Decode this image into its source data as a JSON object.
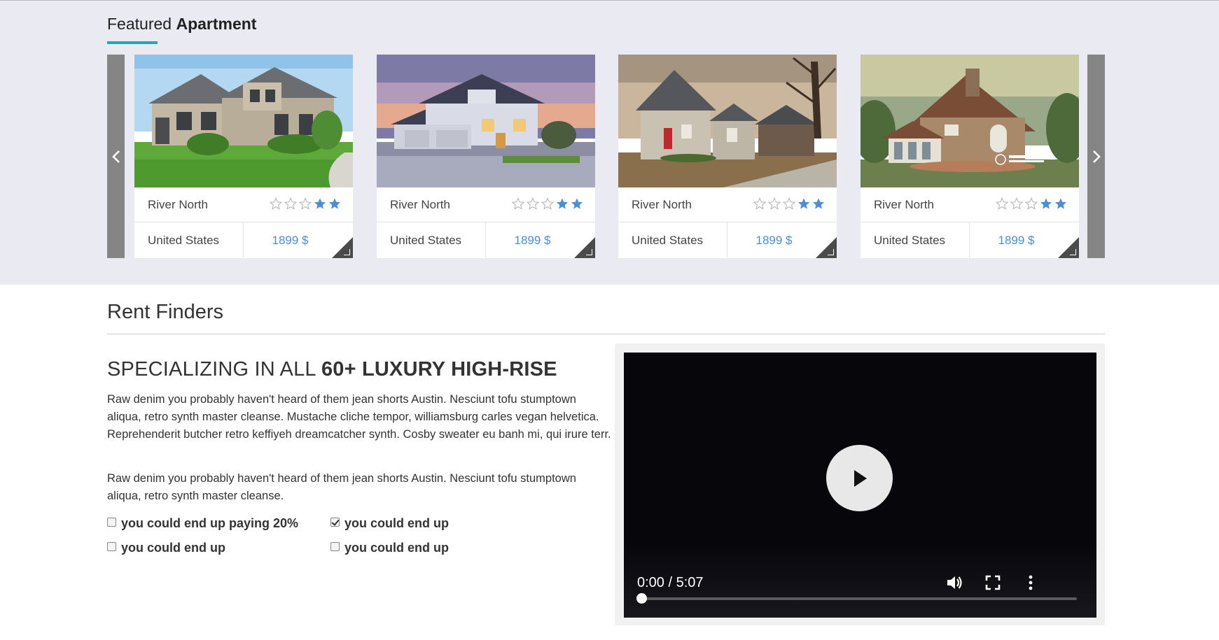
{
  "featured": {
    "title_light": "Featured",
    "title_bold": "Apartment",
    "accent_color": "#1aa9be",
    "prev_icon": "chevron-left-icon",
    "next_icon": "chevron-right-icon",
    "cards": [
      {
        "location": "River North",
        "country": "United States",
        "price": "1899 $",
        "rating": 2,
        "rating_max": 5
      },
      {
        "location": "River North",
        "country": "United States",
        "price": "1899 $",
        "rating": 2,
        "rating_max": 5
      },
      {
        "location": "River North",
        "country": "United States",
        "price": "1899 $",
        "rating": 2,
        "rating_max": 5
      },
      {
        "location": "River North",
        "country": "United States",
        "price": "1899 $",
        "rating": 2,
        "rating_max": 5
      }
    ]
  },
  "rent": {
    "title": "Rent Finders",
    "headline_light": "SPECIALIZING IN ALL ",
    "headline_bold": "60+ LUXURY HIGH-RISE",
    "paragraph1": "Raw denim you probably haven't heard of them jean shorts Austin. Nesciunt tofu stumptown aliqua, retro synth master cleanse. Mustache cliche tempor, williamsburg carles vegan helvetica. Reprehenderit butcher retro keffiyeh dreamcatcher synth. Cosby sweater eu banh mi, qui irure terr.",
    "paragraph2": "Raw denim you probably haven't heard of them jean shorts Austin. Nesciunt tofu stumptown aliqua, retro synth master cleanse.",
    "checks": [
      {
        "label": "you could end up paying 20%",
        "checked": false
      },
      {
        "label": "you could end up",
        "checked": true
      },
      {
        "label": "you could end up",
        "checked": false
      },
      {
        "label": "you could end up",
        "checked": false
      }
    ]
  },
  "video": {
    "time": "0:00 / 5:07",
    "progress": 0
  }
}
